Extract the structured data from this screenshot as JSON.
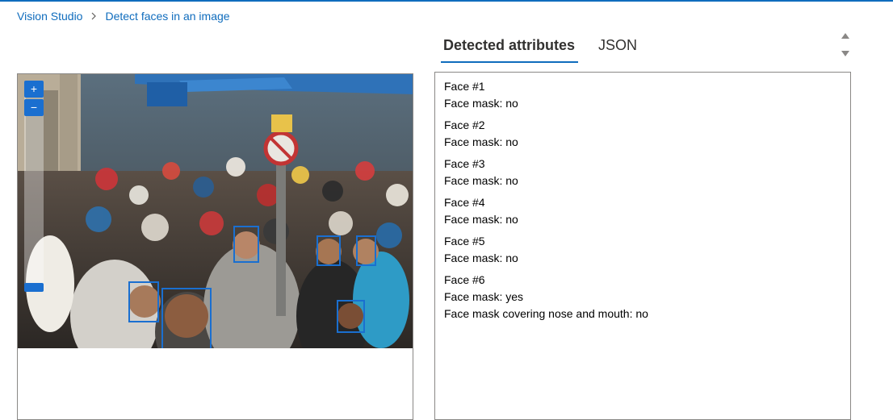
{
  "colors": {
    "accent": "#0f6cbd",
    "top_bar": "#0f6cbd",
    "face_box": "#1a6fd0",
    "link": "#0f6cbd"
  },
  "breadcrumb": {
    "items": [
      {
        "label": "Vision Studio"
      },
      {
        "label": "Detect faces in an image"
      }
    ],
    "separator_icon": "chevron-right-icon"
  },
  "image_viewer": {
    "zoom_in_icon": "plus-icon",
    "zoom_out_icon": "minus-icon",
    "detected_face_count": 6
  },
  "tabs": [
    {
      "label": "Detected attributes",
      "active": true
    },
    {
      "label": "JSON",
      "active": false
    }
  ],
  "faces": [
    {
      "title": "Face #1",
      "lines": [
        "Face mask: no"
      ]
    },
    {
      "title": "Face #2",
      "lines": [
        "Face mask: no"
      ]
    },
    {
      "title": "Face #3",
      "lines": [
        "Face mask: no"
      ]
    },
    {
      "title": "Face #4",
      "lines": [
        "Face mask: no"
      ]
    },
    {
      "title": "Face #5",
      "lines": [
        "Face mask: no"
      ]
    },
    {
      "title": "Face #6",
      "lines": [
        "Face mask: yes",
        "Face mask covering nose and mouth: no"
      ]
    }
  ]
}
